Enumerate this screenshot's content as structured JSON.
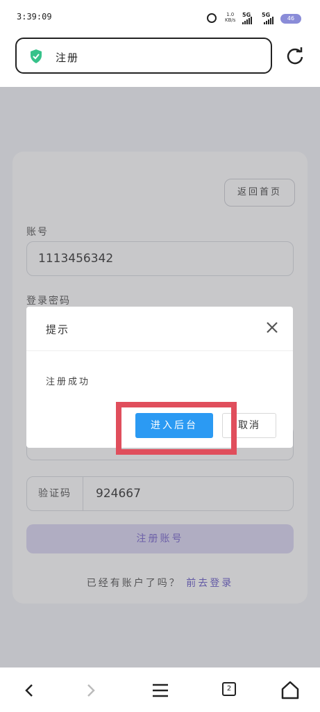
{
  "status_bar": {
    "time": "3:39:09",
    "speed_value": "1.0",
    "speed_unit": "KB/s",
    "network_1": "5G",
    "network_2": "5G",
    "battery": "46"
  },
  "browser": {
    "page_title": "注册",
    "tab_count": "2",
    "icons": [
      "shield-check-icon",
      "reload-icon",
      "back-icon",
      "forward-icon",
      "menu-icon",
      "tabs-icon",
      "home-icon"
    ]
  },
  "form": {
    "back_home_label": "返回首页",
    "account_label": "账号",
    "account_value": "1113456342",
    "password_label": "登录密码",
    "captcha_prefix": "验证码",
    "captcha_value": "924667",
    "submit_label": "注册账号",
    "login_prompt": "已经有账户了吗？",
    "login_link": "前去登录"
  },
  "dialog": {
    "title": "提示",
    "message": "注册成功",
    "ok_label": "进入后台",
    "cancel_label": "取消"
  },
  "colors": {
    "primary": "#2b9af3",
    "highlight": "#e04e5c",
    "accent": "#5b4cc4"
  }
}
